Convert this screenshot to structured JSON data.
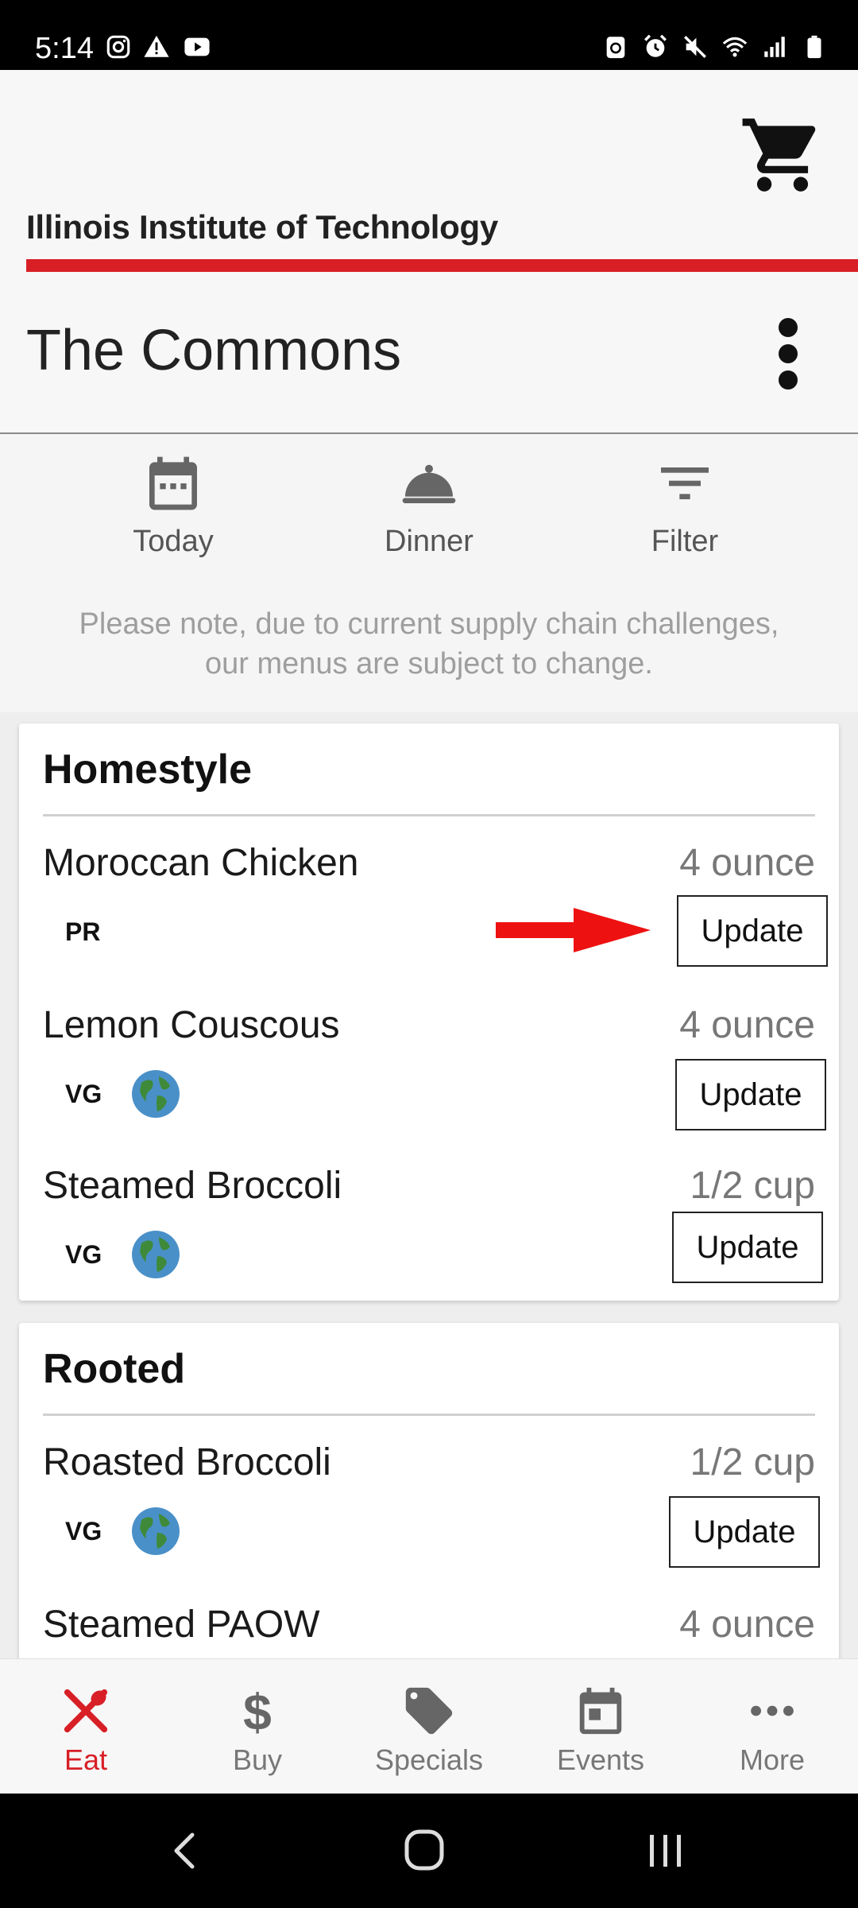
{
  "status_bar": {
    "time": "5:14",
    "left_icons": [
      "instagram-icon",
      "warning-icon",
      "youtube-icon"
    ],
    "right_icons": [
      "recycle-icon",
      "alarm-icon",
      "mute-icon",
      "wifi-icon",
      "signal-icon",
      "battery-icon"
    ]
  },
  "header": {
    "brand": "Illinois Institute of Technology",
    "venue": "The Commons",
    "brand_color": "#d81f26"
  },
  "toolbar": {
    "date_label": "Today",
    "meal_label": "Dinner",
    "filter_label": "Filter",
    "notice": "Please note, due to current supply chain challenges, our menus are subject to change."
  },
  "menu": {
    "stations": [
      {
        "name": "Homestyle",
        "items": [
          {
            "name": "Moroccan Chicken",
            "portion": "4 ounce",
            "badge": "PR",
            "sustainable": false,
            "button": "Update"
          },
          {
            "name": "Lemon Couscous",
            "portion": "4 ounce",
            "badge": "VG",
            "sustainable": true,
            "button": "Update"
          },
          {
            "name": "Steamed Broccoli",
            "portion": "1/2 cup",
            "badge": "VG",
            "sustainable": true,
            "button": "Update"
          }
        ]
      },
      {
        "name": "Rooted",
        "items": [
          {
            "name": "Roasted Broccoli",
            "portion": "1/2 cup",
            "badge": "VG",
            "sustainable": true,
            "button": "Update"
          },
          {
            "name": "Steamed PAOW",
            "portion": "4 ounce"
          }
        ]
      }
    ]
  },
  "bottom_nav": {
    "items": [
      {
        "label": "Eat",
        "icon": "fork-knife-icon",
        "active": true
      },
      {
        "label": "Buy",
        "icon": "dollar-icon",
        "active": false
      },
      {
        "label": "Specials",
        "icon": "tag-icon",
        "active": false
      },
      {
        "label": "Events",
        "icon": "calendar-icon",
        "active": false
      },
      {
        "label": "More",
        "icon": "more-dots-icon",
        "active": false
      }
    ]
  },
  "system_nav": [
    "back-icon",
    "home-icon",
    "recents-icon"
  ]
}
